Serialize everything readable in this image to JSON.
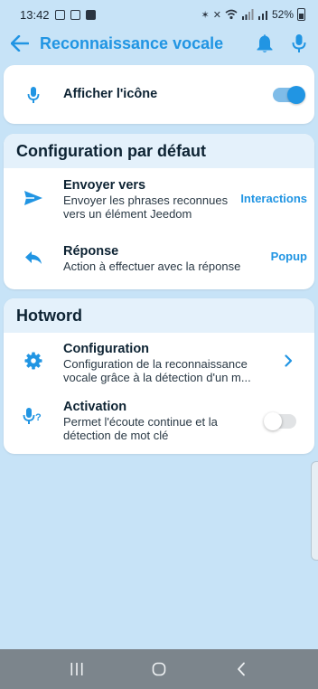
{
  "status_bar": {
    "time": "13:42",
    "battery": "52%"
  },
  "app_bar": {
    "title": "Reconnaissance vocale"
  },
  "card_icon": {
    "label": "Afficher l'icône",
    "toggle_on": true
  },
  "section_default": {
    "header": "Configuration par défaut",
    "items": [
      {
        "title": "Envoyer vers",
        "subtitle_1": "Envoyer les phrases reconnues",
        "subtitle_2": "vers un élément Jeedom",
        "value": "Interactions"
      },
      {
        "title": "Réponse",
        "subtitle_1": "Action à effectuer avec la réponse",
        "value": "Popup"
      }
    ]
  },
  "section_hotword": {
    "header": "Hotword",
    "items": [
      {
        "title": "Configuration",
        "subtitle_1": "Configuration de la reconnaissance",
        "subtitle_2": "vocale grâce à la détection d'un m..."
      },
      {
        "title": "Activation",
        "subtitle_1": "Permet l'écoute continue et la",
        "subtitle_2": "détection de mot clé",
        "toggle_on": false
      }
    ]
  },
  "colors": {
    "accent": "#2195e3",
    "background": "#c7e3f7",
    "header_bg": "#e4f1fb",
    "nav_bar": "#7c858c"
  },
  "icons": {
    "back": "arrow-left-icon",
    "notifications": "bell-icon",
    "voice": "microphone-icon",
    "send": "send-icon",
    "reply": "reply-icon",
    "settings": "gear-icon",
    "voice_question": "microphone-question-icon"
  }
}
